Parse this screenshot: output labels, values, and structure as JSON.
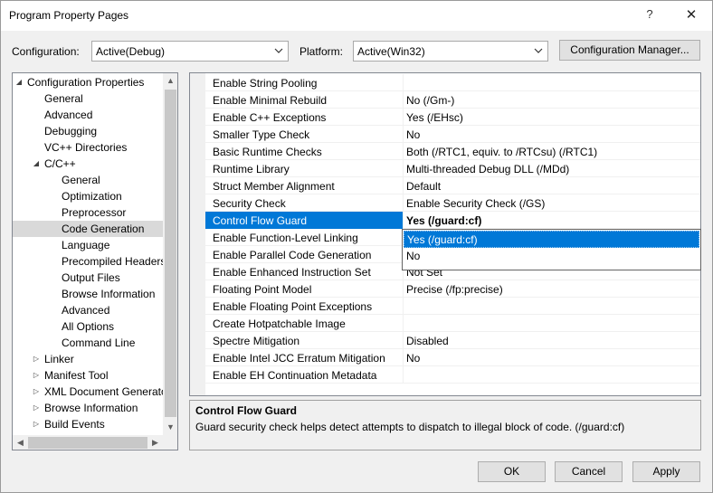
{
  "window": {
    "title": "Program Property Pages",
    "help_label": "?",
    "close_label": "✕"
  },
  "toolbar": {
    "configuration_label": "Configuration:",
    "configuration_value": "Active(Debug)",
    "platform_label": "Platform:",
    "platform_value": "Active(Win32)",
    "config_manager_label": "Configuration Manager..."
  },
  "tree": {
    "items": [
      {
        "label": "Configuration Properties",
        "expander": "◢",
        "selected": false
      },
      {
        "label": "General"
      },
      {
        "label": "Advanced"
      },
      {
        "label": "Debugging"
      },
      {
        "label": "VC++ Directories"
      },
      {
        "label": "C/C++",
        "expander": "◢"
      },
      {
        "label": "General"
      },
      {
        "label": "Optimization"
      },
      {
        "label": "Preprocessor"
      },
      {
        "label": "Code Generation",
        "selected": true
      },
      {
        "label": "Language"
      },
      {
        "label": "Precompiled Headers"
      },
      {
        "label": "Output Files"
      },
      {
        "label": "Browse Information"
      },
      {
        "label": "Advanced"
      },
      {
        "label": "All Options"
      },
      {
        "label": "Command Line"
      },
      {
        "label": "Linker",
        "expander": "▷"
      },
      {
        "label": "Manifest Tool",
        "expander": "▷"
      },
      {
        "label": "XML Document Generator",
        "expander": "▷"
      },
      {
        "label": "Browse Information",
        "expander": "▷"
      },
      {
        "label": "Build Events",
        "expander": "▷"
      }
    ]
  },
  "properties": [
    {
      "name": "Enable String Pooling",
      "value": ""
    },
    {
      "name": "Enable Minimal Rebuild",
      "value": "No (/Gm-)"
    },
    {
      "name": "Enable C++ Exceptions",
      "value": "Yes (/EHsc)"
    },
    {
      "name": "Smaller Type Check",
      "value": "No"
    },
    {
      "name": "Basic Runtime Checks",
      "value": "Both (/RTC1, equiv. to /RTCsu) (/RTC1)"
    },
    {
      "name": "Runtime Library",
      "value": "Multi-threaded Debug DLL (/MDd)"
    },
    {
      "name": "Struct Member Alignment",
      "value": "Default"
    },
    {
      "name": "Security Check",
      "value": "Enable Security Check (/GS)"
    },
    {
      "name": "Control Flow Guard",
      "value": "Yes (/guard:cf)",
      "selected": true
    },
    {
      "name": "Enable Function-Level Linking",
      "value": ""
    },
    {
      "name": "Enable Parallel Code Generation",
      "value": ""
    },
    {
      "name": "Enable Enhanced Instruction Set",
      "value": "Not Set"
    },
    {
      "name": "Floating Point Model",
      "value": "Precise (/fp:precise)"
    },
    {
      "name": "Enable Floating Point Exceptions",
      "value": ""
    },
    {
      "name": "Create Hotpatchable Image",
      "value": ""
    },
    {
      "name": "Spectre Mitigation",
      "value": "Disabled"
    },
    {
      "name": "Enable Intel JCC Erratum Mitigation",
      "value": "No"
    },
    {
      "name": "Enable EH Continuation Metadata",
      "value": ""
    }
  ],
  "dropdown": {
    "options": [
      "Yes (/guard:cf)",
      "No"
    ],
    "highlighted_index": 0
  },
  "description": {
    "title": "Control Flow Guard",
    "text": "Guard security check helps detect attempts to dispatch to illegal block of code. (/guard:cf)"
  },
  "buttons": {
    "ok": "OK",
    "cancel": "Cancel",
    "apply": "Apply"
  },
  "colors": {
    "selection": "#0078d7",
    "tree_selection": "#d9d9d9"
  }
}
